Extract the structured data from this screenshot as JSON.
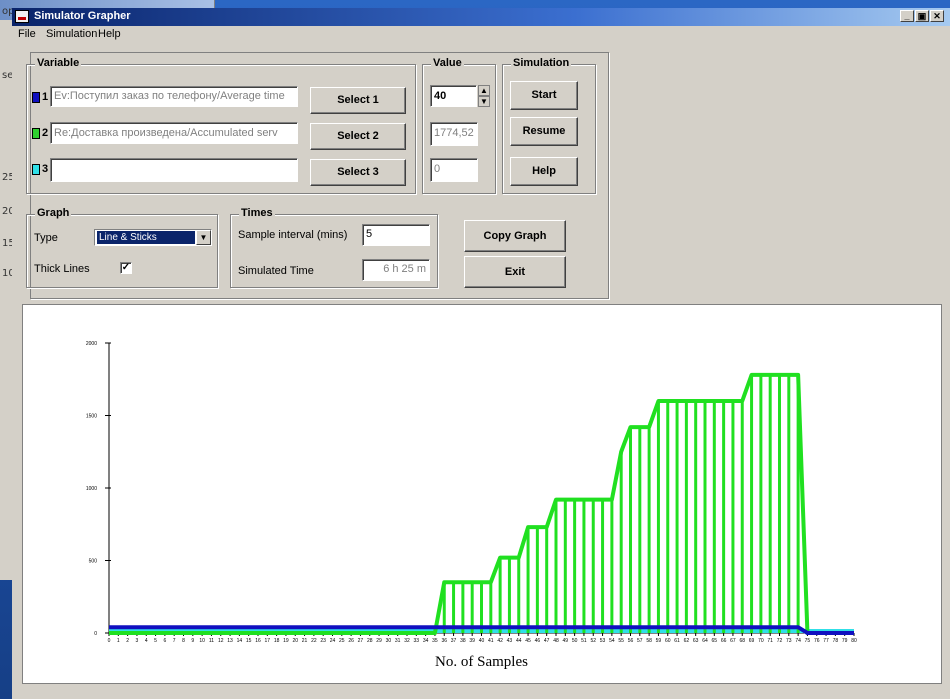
{
  "window": {
    "title": "Simulator Grapher",
    "controls": [
      "_",
      "&#x2B1C;",
      "x"
    ]
  },
  "menu": [
    "File",
    "Simulation",
    "Help"
  ],
  "background_window": {
    "fragments": [
      "op",
      "se",
      "25",
      "20",
      "15",
      "10"
    ]
  },
  "variable": {
    "title": "Variable",
    "rows": [
      {
        "num": "1",
        "color": "#1010c0",
        "value": "Ev:Поступил заказ по телефону/Average time",
        "button": "Select 1"
      },
      {
        "num": "2",
        "color": "#2fd02f",
        "value": "Re:Доставка произведена/Accumulated serv",
        "button": "Select 2"
      },
      {
        "num": "3",
        "color": "#30e0e8",
        "value": "",
        "button": "Select 3"
      }
    ]
  },
  "value": {
    "title": "Value",
    "v1": "40",
    "v2": "1774,52",
    "v3": "0"
  },
  "simulation": {
    "title": "Simulation",
    "start": "Start",
    "resume": "Resume",
    "help": "Help"
  },
  "graph_opts": {
    "title": "Graph",
    "type_label": "Type",
    "type_value": "Line & Sticks",
    "thick_label": "Thick Lines",
    "thick_checked": true
  },
  "times": {
    "title": "Times",
    "sample_label": "Sample interval (mins)",
    "sample_value": "5",
    "simtime_label": "Simulated Time",
    "simtime_value": "6 h 25 m"
  },
  "buttons": {
    "copy": "Copy Graph",
    "exit": "Exit"
  },
  "chart_data": {
    "type": "line",
    "xlabel": "No. of Samples",
    "ylabel": "",
    "xlim": [
      0,
      80
    ],
    "ylim": [
      0,
      2000
    ],
    "yticks": [
      0,
      500,
      1000,
      1500,
      2000
    ],
    "series": [
      {
        "color": "#1010c0",
        "values": [
          40,
          40,
          40,
          40,
          40,
          40,
          40,
          40,
          40,
          40,
          40,
          40,
          40,
          40,
          40,
          40,
          40,
          40,
          40,
          40,
          40,
          40,
          40,
          40,
          40,
          40,
          40,
          40,
          40,
          40,
          40,
          40,
          40,
          40,
          40,
          40,
          40,
          40,
          40,
          40,
          40,
          40,
          40,
          40,
          40,
          40,
          40,
          40,
          40,
          40,
          40,
          40,
          40,
          40,
          40,
          40,
          40,
          40,
          40,
          40,
          40,
          40,
          40,
          40,
          40,
          40,
          40,
          40,
          40,
          40,
          40,
          40,
          40,
          40,
          40,
          0,
          0,
          0,
          0,
          0,
          0
        ]
      },
      {
        "color": "#20e020",
        "values": [
          0,
          0,
          0,
          0,
          0,
          0,
          0,
          0,
          0,
          0,
          0,
          0,
          0,
          0,
          0,
          0,
          0,
          0,
          0,
          0,
          0,
          0,
          0,
          0,
          0,
          0,
          0,
          0,
          0,
          0,
          0,
          0,
          0,
          0,
          0,
          0,
          350,
          350,
          350,
          350,
          350,
          350,
          520,
          520,
          520,
          730,
          730,
          730,
          920,
          920,
          920,
          920,
          920,
          920,
          920,
          1250,
          1420,
          1420,
          1420,
          1600,
          1600,
          1600,
          1600,
          1600,
          1600,
          1600,
          1600,
          1600,
          1600,
          1780,
          1780,
          1780,
          1780,
          1780,
          1780,
          0,
          0,
          0,
          0,
          0,
          0
        ]
      },
      {
        "color": "#30e0e8",
        "values": [
          0,
          0,
          0,
          0,
          0,
          0,
          0,
          0,
          0,
          0,
          0,
          0,
          0,
          0,
          0,
          0,
          0,
          0,
          0,
          0,
          0,
          0,
          0,
          0,
          0,
          0,
          0,
          0,
          0,
          0,
          0,
          0,
          0,
          0,
          0,
          0,
          0,
          0,
          0,
          0,
          0,
          0,
          0,
          0,
          0,
          0,
          0,
          0,
          0,
          0,
          0,
          0,
          0,
          0,
          0,
          0,
          0,
          0,
          0,
          0,
          0,
          0,
          0,
          0,
          0,
          0,
          0,
          0,
          0,
          0,
          0,
          0,
          0,
          0,
          0,
          0,
          0,
          0,
          0,
          0,
          0
        ]
      }
    ]
  }
}
